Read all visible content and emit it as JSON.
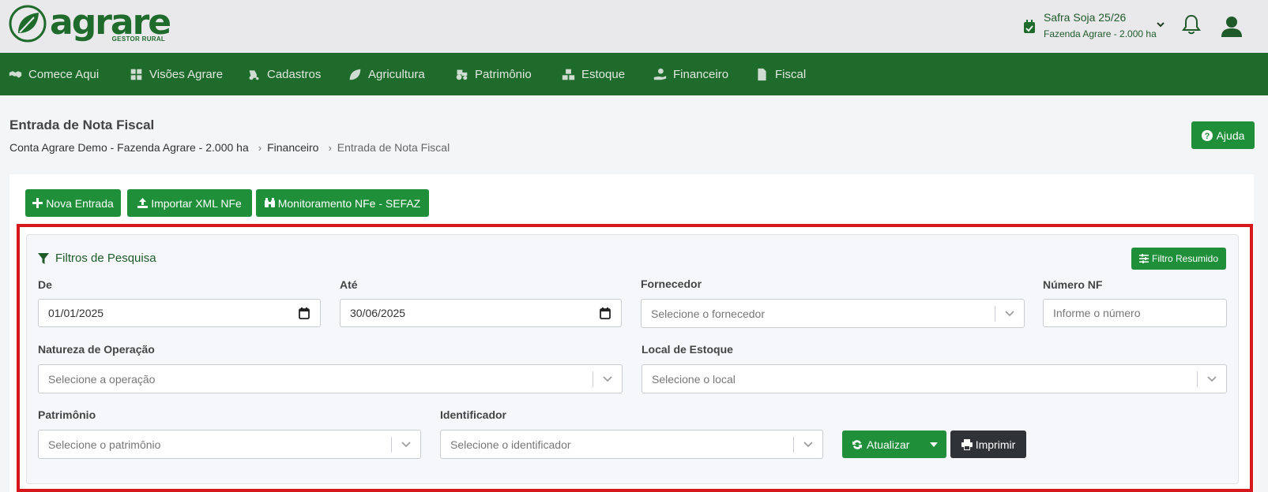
{
  "brand": {
    "name": "agrare",
    "tagline": "GESTOR RURAL",
    "color": "#1f6b2c"
  },
  "header": {
    "safra_title": "Safra Soja 25/26",
    "safra_farm": "Fazenda Agrare - 2.000 ha"
  },
  "nav": {
    "items": [
      {
        "label": "Comece Aqui",
        "icon": "handshake-icon"
      },
      {
        "label": "Visões Agrare",
        "icon": "dashboard-icon"
      },
      {
        "label": "Cadastros",
        "icon": "tractor-icon"
      },
      {
        "label": "Agricultura",
        "icon": "leaf-icon"
      },
      {
        "label": "Patrimônio",
        "icon": "tractor-icon"
      },
      {
        "label": "Estoque",
        "icon": "boxes-icon"
      },
      {
        "label": "Financeiro",
        "icon": "hand-coin-icon"
      },
      {
        "label": "Fiscal",
        "icon": "file-invoice-icon"
      }
    ]
  },
  "page": {
    "title": "Entrada de Nota Fiscal",
    "breadcrumb": [
      "Conta Agrare Demo - Fazenda Agrare - 2.000 ha",
      "Financeiro",
      "Entrada de Nota Fiscal"
    ],
    "help_label": "Ajuda"
  },
  "actions": {
    "nova_entrada": "Nova Entrada",
    "importar_xml": "Importar XML NFe",
    "monitoramento": "Monitoramento NFe - SEFAZ"
  },
  "filters": {
    "title": "Filtros de Pesquisa",
    "resumido_label": "Filtro Resumido",
    "de": {
      "label": "De",
      "value": "01/01/2025"
    },
    "ate": {
      "label": "Até",
      "value": "30/06/2025"
    },
    "fornecedor": {
      "label": "Fornecedor",
      "placeholder": "Selecione o fornecedor"
    },
    "numero_nf": {
      "label": "Número NF",
      "placeholder": "Informe o número"
    },
    "natureza": {
      "label": "Natureza de Operação",
      "placeholder": "Selecione a operação"
    },
    "local": {
      "label": "Local de Estoque",
      "placeholder": "Selecione o local"
    },
    "patrimonio": {
      "label": "Patrimônio",
      "placeholder": "Selecione o patrimônio"
    },
    "identificador": {
      "label": "Identificador",
      "placeholder": "Selecione o identificador"
    },
    "atualizar_label": "Atualizar",
    "imprimir_label": "Imprimir"
  },
  "colors": {
    "primary": "#1f6b2c",
    "button": "#1f8f3a",
    "highlight": "#d6181c",
    "dark_button": "#2f3338"
  }
}
